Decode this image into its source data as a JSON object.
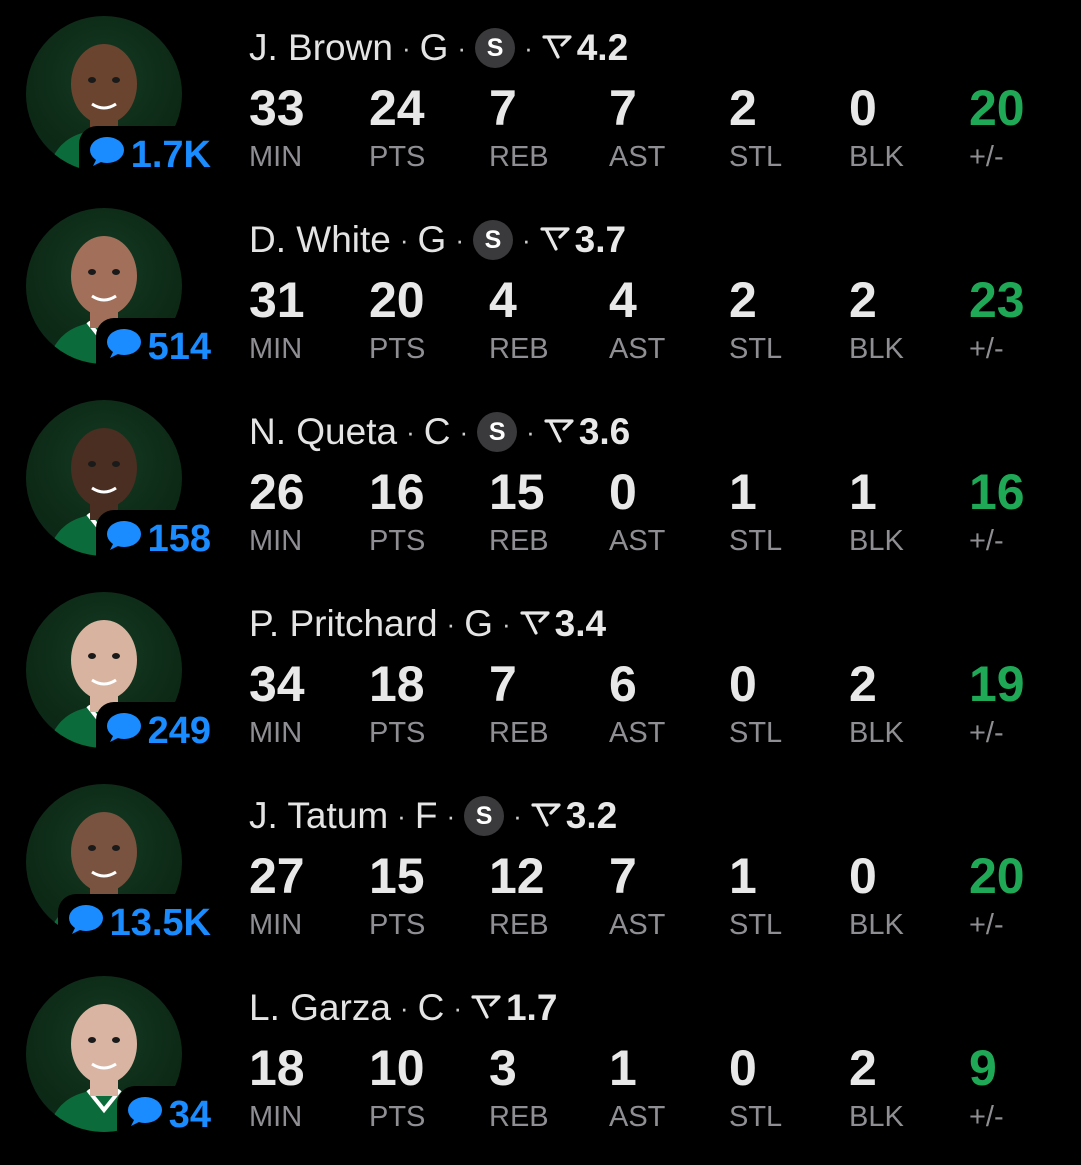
{
  "colors": {
    "background": "#000000",
    "avatar_bg": "#0d2a17",
    "comment_blue": "#1a8cff",
    "plus_minus_green": "#1fa957",
    "label_gray": "#8e8e93",
    "s_badge_bg": "#3a3a3c"
  },
  "stat_labels": [
    "MIN",
    "PTS",
    "REB",
    "AST",
    "STL",
    "BLK",
    "+/-"
  ],
  "players": [
    {
      "name": "J. Brown",
      "position": "G",
      "starter": true,
      "starter_badge": "S",
      "rating": "4.2",
      "comments": "1.7K",
      "stats": [
        "33",
        "24",
        "7",
        "7",
        "2",
        "0",
        "20"
      ],
      "avatar_icon": "player-headshot"
    },
    {
      "name": "D. White",
      "position": "G",
      "starter": true,
      "starter_badge": "S",
      "rating": "3.7",
      "comments": "514",
      "stats": [
        "31",
        "20",
        "4",
        "4",
        "2",
        "2",
        "23"
      ],
      "avatar_icon": "player-headshot"
    },
    {
      "name": "N. Queta",
      "position": "C",
      "starter": true,
      "starter_badge": "S",
      "rating": "3.6",
      "comments": "158",
      "stats": [
        "26",
        "16",
        "15",
        "0",
        "1",
        "1",
        "16"
      ],
      "avatar_icon": "player-headshot"
    },
    {
      "name": "P. Pritchard",
      "position": "G",
      "starter": false,
      "rating": "3.4",
      "comments": "249",
      "stats": [
        "34",
        "18",
        "7",
        "6",
        "0",
        "2",
        "19"
      ],
      "avatar_icon": "player-headshot"
    },
    {
      "name": "J. Tatum",
      "position": "F",
      "starter": true,
      "starter_badge": "S",
      "rating": "3.2",
      "comments": "13.5K",
      "stats": [
        "27",
        "15",
        "12",
        "7",
        "1",
        "0",
        "20"
      ],
      "avatar_icon": "player-headshot"
    },
    {
      "name": "L. Garza",
      "position": "C",
      "starter": false,
      "rating": "1.7",
      "comments": "34",
      "stats": [
        "18",
        "10",
        "3",
        "1",
        "0",
        "2",
        "9"
      ],
      "avatar_icon": "player-headshot"
    }
  ]
}
